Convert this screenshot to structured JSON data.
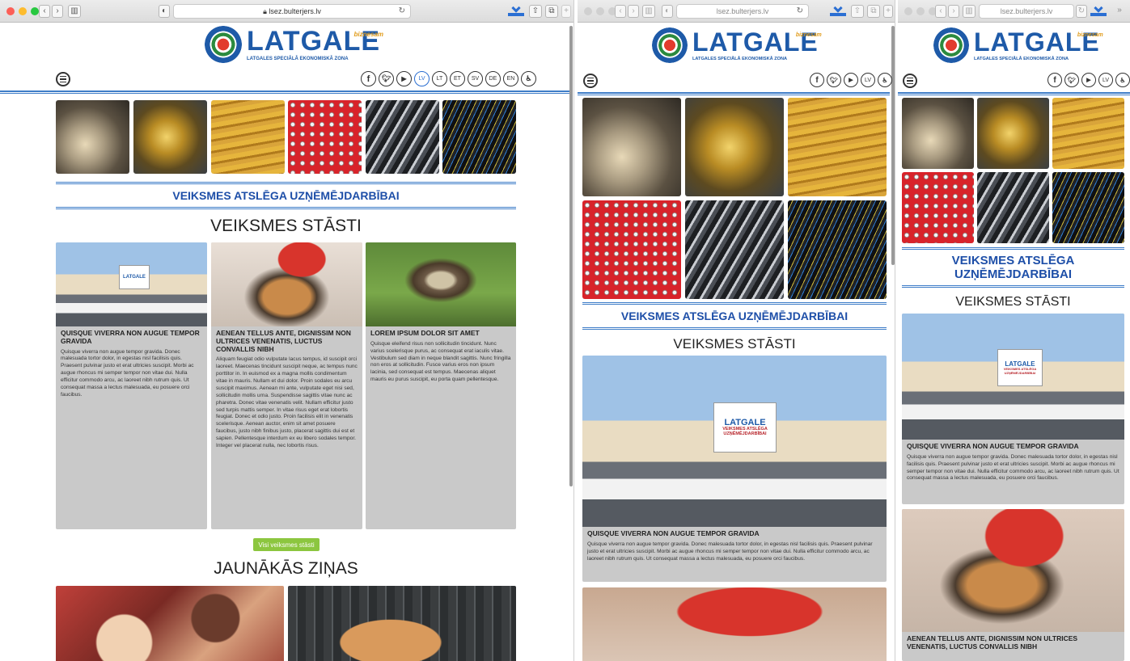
{
  "browser": {
    "url": "lsez.bulterjers.lv"
  },
  "logo": {
    "name": "LATGALE",
    "tag": "biznesam",
    "subtitle": "LATGALES SPECIĀLĀ EKONOMISKĀ ZONA"
  },
  "nav": {
    "languages": [
      "LV",
      "LT",
      "ET",
      "SV",
      "DE",
      "EN"
    ],
    "active_language": "LV",
    "social_icons": [
      "facebook-icon",
      "twitter-icon",
      "youtube-icon"
    ]
  },
  "band": {
    "title": "VEIKSMES ATSLĒGA UZŅĒMĒJDARBĪBAI",
    "title_line1": "VEIKSMES ATSLĒGA",
    "title_line2": "UZŅĒMĒJDARBĪBAI"
  },
  "stories": {
    "heading": "VEIKSMES STĀSTI",
    "cards": [
      {
        "title": "QUISQUE VIVERRA NON AUGUE TEMPOR GRAVIDA",
        "title_w1": "QUISQUE VIVERRA NON AUGUE TEMPOR GRAVIDA",
        "body": "Quisque viverra non augue tempor gravida. Donec malesuada tortor dolor, in egestas nisl facilisis quis. Praesent pulvinar justo et erat ultricies suscipit. Morbi ac augue rhoncus mi semper tempor non vitae dui. Nulla efficitur commodo arcu, ac laoreet nibh rutrum quis. Ut consequat massa a lectus malesuada, eu posuere orci faucibus."
      },
      {
        "title": "AENEAN TELLUS ANTE, DIGNISSIM NON ULTRICES VENENATIS, LUCTUS CONVALLIS NIBH",
        "body": "Aliquam feugiat odio vulputate lacus tempus, id suscipit orci laoreet. Maecenas tincidunt suscipit neque, ac tempus nunc porttitor in. In euismod ex a magna mollis condimentum vitae in mauris. Nullam et dui dolor. Proin sodales eu arcu suscipit maximus. Aenean mi ante, vulputate eget nisi sed, sollicitudin mollis urna. Suspendisse sagittis vitae nunc ac pharetra. Donec vitae venenatis velit. Nullam efficitur justo sed turpis mattis semper. In vitae risus eget erat lobortis feugiat. Donec et odio justo. Proin facilisis elit in venenatis scelerisque. Aenean auctor, enim sit amet posuere faucibus, justo nibh finibus justo, placerat sagittis dui est et sapien. Pellentesque interdum ex eu libero sodales tempor. Integer vel placerat nulla, nec lobortis risus."
      },
      {
        "title": "LOREM IPSUM DOLOR SIT AMET",
        "body": "Quisque eleifend risus non sollicitudin tincidunt. Nunc varius scelerisque purus, ac consequat erat iaculis vitae. Vestibulum sed diam in neque blandit sagittis. Nunc fringilla non eros at sollicitudin. Fusce varius eros non ipsum lacinia, sed consequat est tempus. Maecenas aliquet mauris eu purus suscipit, eu porta quam pellentesque."
      }
    ],
    "all_button": "Visi veiksmes stāsti"
  },
  "news": {
    "heading": "JAUNĀKĀS ZIŅAS"
  },
  "billboard": {
    "logo": "LATGALE",
    "line1": "VEIKSMES ATSLĒGA",
    "line2": "UZŅĒMĒJDARBĪBAI"
  },
  "colors": {
    "brand_blue": "#1e5aa8",
    "rule_blue": "#3e7dc8",
    "card_gray": "#c9c9c9",
    "button_green": "#8cc63f",
    "logo_accent": "#e09b1a"
  }
}
